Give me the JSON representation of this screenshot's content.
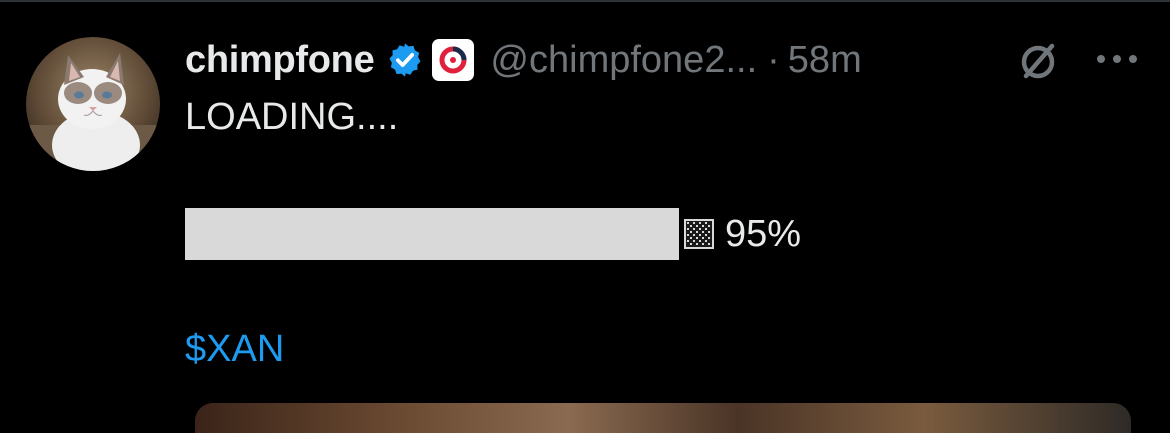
{
  "post": {
    "author": {
      "display_name": "chimpfone",
      "handle": "@chimpfone2...",
      "verified": true,
      "avatar_icon": "cat-avatar"
    },
    "separator": "·",
    "timestamp": "58m",
    "lines": {
      "first": "LOADING....",
      "cashtag": "$XAN"
    },
    "progress": {
      "percent_label": "95%",
      "fraction": 0.95,
      "remaining_icon": "checkered-square-icon"
    },
    "icons": {
      "grok": "grok-icon",
      "more": "more-options-icon",
      "verified": "verified-badge-icon",
      "affiliate": "affiliate-badge-icon"
    }
  },
  "colors": {
    "background": "#000000",
    "primary_text": "#e7e9ea",
    "secondary_text": "#71767b",
    "accent": "#1d9bf0",
    "progress_fill": "#d9d9d9"
  }
}
